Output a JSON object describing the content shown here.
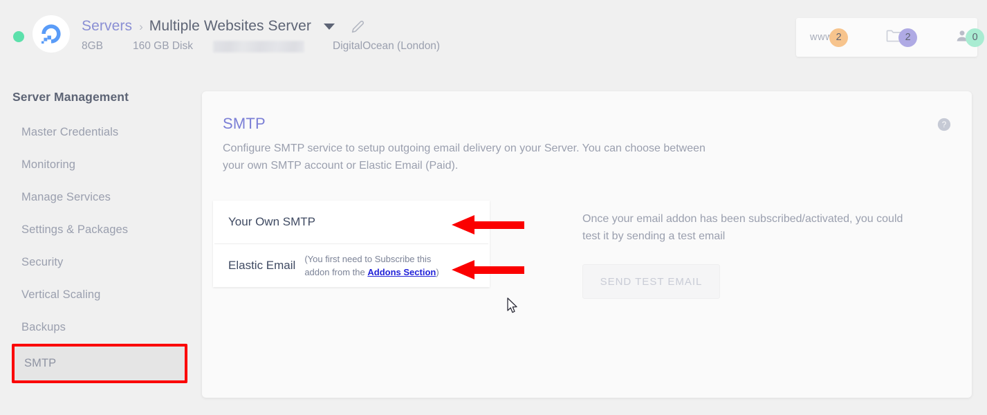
{
  "header": {
    "status": "online",
    "breadcrumb": {
      "root": "Servers",
      "separator": "›",
      "current": "Multiple Websites Server"
    },
    "meta": {
      "ram": "8GB",
      "disk": "160 GB Disk",
      "ip": "",
      "provider": "DigitalOcean (London)"
    },
    "counters": [
      {
        "icon": "www-icon",
        "label": "www",
        "count": "2",
        "color": "#f7c48d"
      },
      {
        "icon": "folder-icon",
        "label": "",
        "count": "2",
        "color": "#afaae4"
      },
      {
        "icon": "user-icon",
        "label": "",
        "count": "0",
        "color": "#a9ecd2"
      }
    ]
  },
  "sidebar": {
    "title": "Server Management",
    "items": [
      {
        "label": "Master Credentials",
        "active": false
      },
      {
        "label": "Monitoring",
        "active": false
      },
      {
        "label": "Manage Services",
        "active": false
      },
      {
        "label": "Settings & Packages",
        "active": false
      },
      {
        "label": "Security",
        "active": false
      },
      {
        "label": "Vertical Scaling",
        "active": false
      },
      {
        "label": "Backups",
        "active": false
      },
      {
        "label": "SMTP",
        "active": true
      }
    ]
  },
  "card": {
    "title": "SMTP",
    "help_icon": "help-circle-icon",
    "description": "Configure SMTP service to setup outgoing email delivery on your Server. You can choose between your own SMTP account or Elastic Email (Paid).",
    "options": [
      {
        "label": "Your Own SMTP",
        "note_prefix": "",
        "note_suffix": "",
        "link": ""
      },
      {
        "label": "Elastic Email",
        "note_prefix": "(You first need to Subscribe this addon from the ",
        "link": "Addons Section",
        "note_suffix": ")"
      }
    ],
    "right": {
      "text": "Once your email addon has been subscribed/activated, you could test it by sending a test email",
      "button_label": "SEND TEST EMAIL",
      "button_disabled": true
    }
  },
  "annotations": {
    "arrow_color": "#fb0000",
    "highlight_color": "#fb0000",
    "arrows": [
      "points-to-your-own-smtp",
      "points-to-elastic-email"
    ]
  }
}
